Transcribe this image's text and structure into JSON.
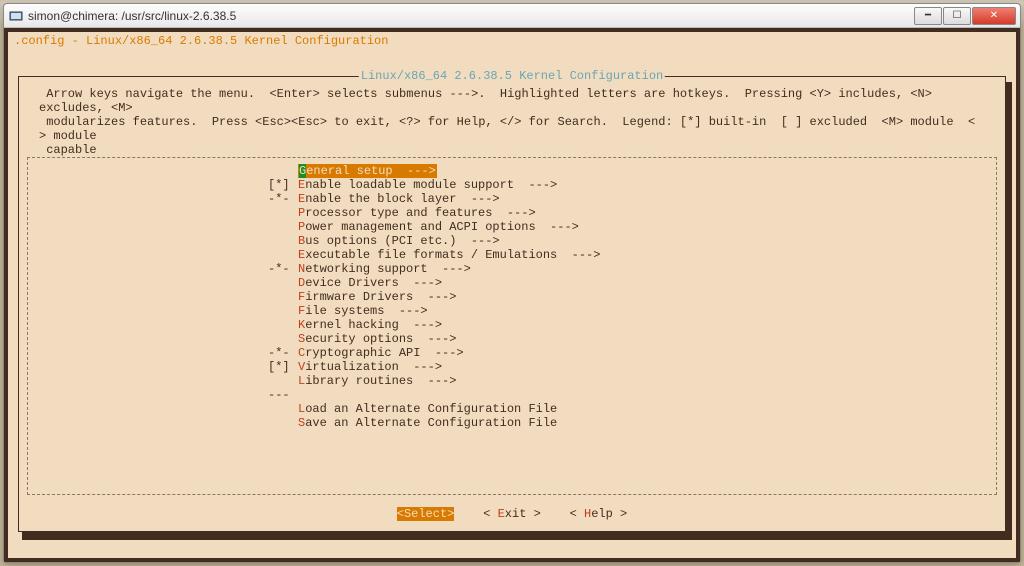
{
  "window": {
    "title": "simon@chimera: /usr/src/linux-2.6.38.5",
    "minimize": "━",
    "maximize": "☐",
    "close": "✕"
  },
  "terminal": {
    "header": ".config - Linux/x86_64 2.6.38.5 Kernel Configuration",
    "box_title": "Linux/x86_64 2.6.38.5 Kernel Configuration",
    "help": " Arrow keys navigate the menu.  <Enter> selects submenus --->.  Highlighted letters are hotkeys.  Pressing <Y> includes, <N> excludes, <M>\n modularizes features.  Press <Esc><Esc> to exit, <?> for Help, </> for Search.  Legend: [*] built-in  [ ] excluded  <M> module  < > module\n capable"
  },
  "menu": [
    {
      "marker": "   ",
      "hk": "G",
      "rest": "eneral setup  --->",
      "selected": true
    },
    {
      "marker": "[*]",
      "hk": "E",
      "rest": "nable loadable module support  --->"
    },
    {
      "marker": "-*-",
      "hk": "E",
      "rest": "nable the block layer  --->"
    },
    {
      "marker": "   ",
      "hk": "P",
      "rest": "rocessor type and features  --->"
    },
    {
      "marker": "   ",
      "hk": "P",
      "rest": "ower management and ACPI options  --->"
    },
    {
      "marker": "   ",
      "hk": "B",
      "rest": "us options (PCI etc.)  --->"
    },
    {
      "marker": "   ",
      "hk": "E",
      "rest": "xecutable file formats / Emulations  --->"
    },
    {
      "marker": "-*-",
      "hk": "N",
      "rest": "etworking support  --->"
    },
    {
      "marker": "   ",
      "hk": "D",
      "rest": "evice Drivers  --->"
    },
    {
      "marker": "   ",
      "hk": "F",
      "rest": "irmware Drivers  --->"
    },
    {
      "marker": "   ",
      "hk": "F",
      "rest": "ile systems  --->"
    },
    {
      "marker": "   ",
      "hk": "K",
      "rest": "ernel hacking  --->"
    },
    {
      "marker": "   ",
      "hk": "S",
      "rest": "ecurity options  --->"
    },
    {
      "marker": "-*-",
      "hk": "C",
      "rest": "ryptographic API  --->"
    },
    {
      "marker": "[*]",
      "hk": "V",
      "rest": "irtualization  --->"
    },
    {
      "marker": "   ",
      "hk": "L",
      "rest": "ibrary routines  --->"
    },
    {
      "marker": "---",
      "hk": "",
      "rest": ""
    },
    {
      "marker": "   ",
      "hk": "L",
      "rest": "oad an Alternate Configuration File"
    },
    {
      "marker": "   ",
      "hk": "S",
      "rest": "ave an Alternate Configuration File"
    }
  ],
  "buttons": {
    "select": {
      "open": "<",
      "hk": "S",
      "rest": "elect>",
      "active": true
    },
    "exit": {
      "open": "< ",
      "hk": "E",
      "rest": "xit >"
    },
    "help": {
      "open": "< ",
      "hk": "H",
      "rest": "elp >"
    }
  }
}
